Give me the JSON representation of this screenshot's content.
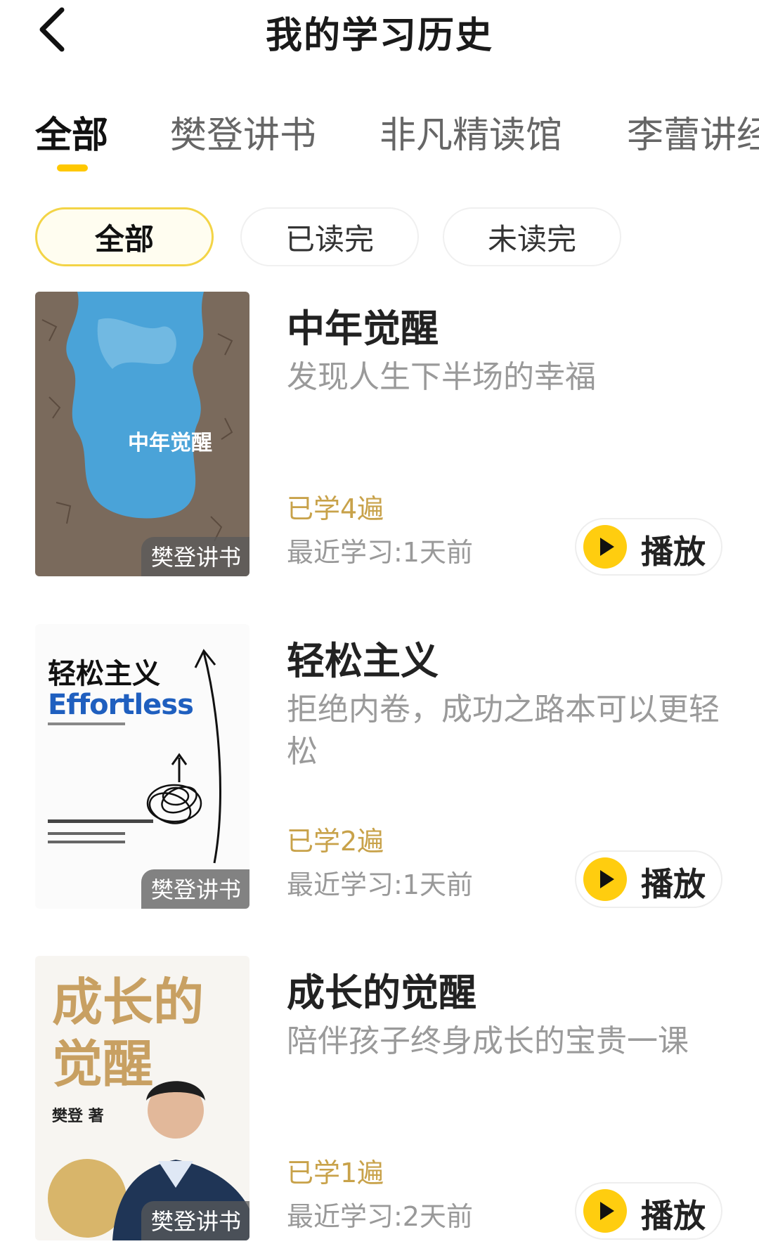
{
  "header": {
    "title": "我的学习历史",
    "back_icon": "chevron-left-icon"
  },
  "tabs": [
    {
      "label": "全部",
      "active": true
    },
    {
      "label": "樊登讲书",
      "active": false
    },
    {
      "label": "非凡精读馆",
      "active": false
    },
    {
      "label": "李蕾讲经",
      "active": false
    }
  ],
  "filters": [
    {
      "label": "全部",
      "active": true
    },
    {
      "label": "已读完",
      "active": false
    },
    {
      "label": "未读完",
      "active": false
    }
  ],
  "colors": {
    "accent": "#ffc800",
    "study_count": "#c8a24a",
    "muted": "#999999"
  },
  "items": [
    {
      "title": "中年觉醒",
      "subtitle": "发现人生下半场的幸福",
      "study_count": "已学4遍",
      "last_study": "最近学习:1天前",
      "tag": "樊登讲书",
      "play_label": "播放",
      "cover_title": "中年觉醒"
    },
    {
      "title": "轻松主义",
      "subtitle": "拒绝内卷，成功之路本可以更轻松",
      "study_count": "已学2遍",
      "last_study": "最近学习:1天前",
      "tag": "樊登讲书",
      "play_label": "播放",
      "cover_title": "轻松主义",
      "cover_en": "Effortless"
    },
    {
      "title": "成长的觉醒",
      "subtitle": "陪伴孩子终身成长的宝贵一课",
      "study_count": "已学1遍",
      "last_study": "最近学习:2天前",
      "tag": "樊登讲书",
      "play_label": "播放",
      "cover_title": "成长的觉醒",
      "cover_author": "樊登 著"
    }
  ]
}
